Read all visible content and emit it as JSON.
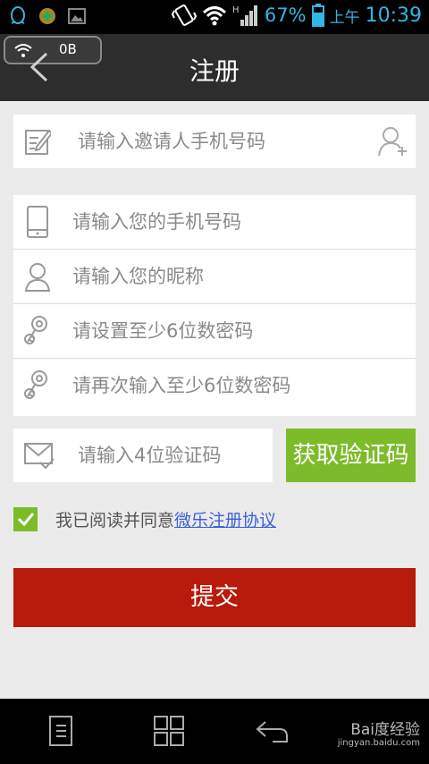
{
  "status_bar": {
    "battery_percent": "67%",
    "ampm": "上午",
    "time": "10:39",
    "accent_color": "#33b5e5"
  },
  "header": {
    "title": "注册",
    "data_usage": "0B"
  },
  "form": {
    "inviter_placeholder": "请输入邀请人手机号码",
    "phone_placeholder": "请输入您的手机号码",
    "nickname_placeholder": "请输入您的昵称",
    "password_placeholder": "请设置至少6位数密码",
    "password_confirm_placeholder": "请再次输入至少6位数密码",
    "code_placeholder": "请输入4位验证码",
    "get_code_label": "获取验证码",
    "agree_prefix": "我已阅读并同意",
    "agree_link": "微乐注册协议",
    "agree_checked": true,
    "submit_label": "提交"
  },
  "watermark": {
    "brand": "Bai度经验",
    "url": "jingyan.baidu.com"
  },
  "colors": {
    "green": "#7dbb2b",
    "submit_red": "#b81a0b",
    "titlebar": "#2d2d2d",
    "background": "#ebebeb"
  }
}
